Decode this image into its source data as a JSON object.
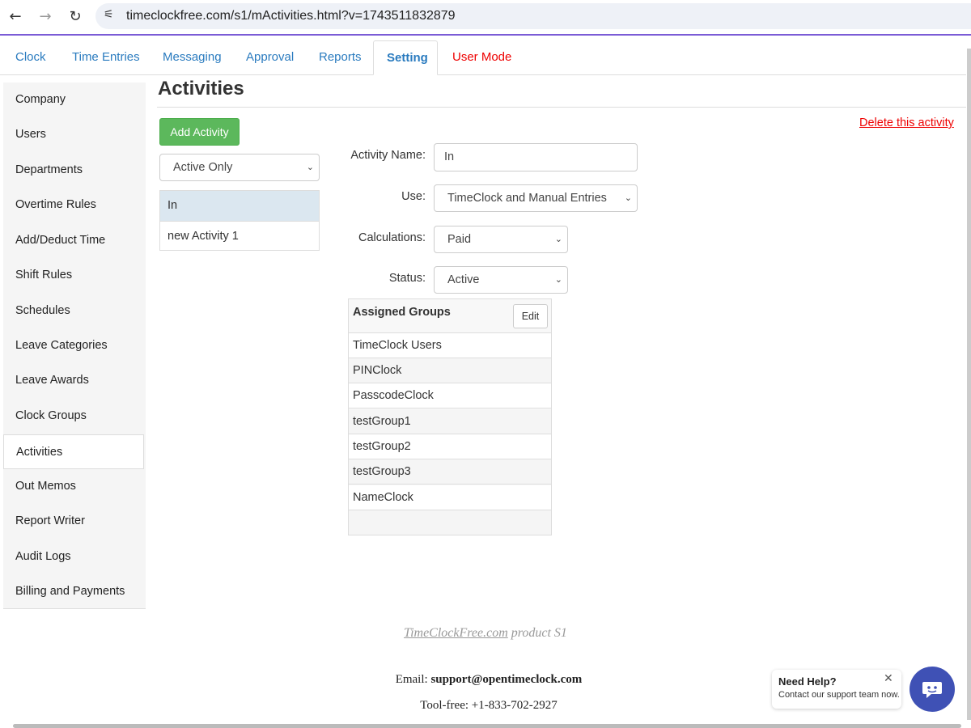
{
  "browser": {
    "back_icon": "←",
    "forward_icon": "→",
    "reload_icon": "↻",
    "site_icon": "⚟",
    "url": "timeclockfree.com/s1/mActivities.html?v=1743511832879"
  },
  "tabs": [
    {
      "label": "Clock"
    },
    {
      "label": "Time Entries"
    },
    {
      "label": "Messaging"
    },
    {
      "label": "Approval"
    },
    {
      "label": "Reports"
    },
    {
      "label": "Setting"
    },
    {
      "label": "User Mode"
    }
  ],
  "sidebar": {
    "items": [
      {
        "label": "Company"
      },
      {
        "label": "Users"
      },
      {
        "label": "Departments"
      },
      {
        "label": "Overtime Rules"
      },
      {
        "label": "Add/Deduct Time"
      },
      {
        "label": "Shift Rules"
      },
      {
        "label": "Schedules"
      },
      {
        "label": "Leave Categories"
      },
      {
        "label": "Leave Awards"
      },
      {
        "label": "Clock Groups"
      },
      {
        "label": "Activities"
      },
      {
        "label": "Out Memos"
      },
      {
        "label": "Report Writer"
      },
      {
        "label": "Audit Logs"
      },
      {
        "label": "Billing and Payments"
      }
    ]
  },
  "main": {
    "title": "Activities",
    "delete_link": "Delete this activity",
    "add_button": "Add Activity",
    "filter_select": "Active Only",
    "activities": [
      {
        "label": "In"
      },
      {
        "label": "new Activity 1"
      }
    ],
    "form": {
      "name_label": "Activity Name:",
      "name_value": "In",
      "use_label": "Use:",
      "use_value": "TimeClock and Manual Entries",
      "calc_label": "Calculations:",
      "calc_value": "Paid",
      "status_label": "Status:",
      "status_value": "Active"
    },
    "groups": {
      "title": "Assigned Groups",
      "edit_label": "Edit",
      "rows": [
        "TimeClock Users",
        "PINClock",
        "PasscodeClock",
        "testGroup1",
        "testGroup2",
        "testGroup3",
        "NameClock",
        ""
      ]
    }
  },
  "footer": {
    "product_link": "TimeClockFree.com",
    "product_suffix": " product S1",
    "email_label": "Email: ",
    "email_value": "support@opentimeclock.com",
    "phone": "Tool-free: +1-833-702-2927"
  },
  "help": {
    "title": "Need Help?",
    "subtitle": "Contact our support team now.",
    "close_icon": "✕"
  },
  "chevron": "⌄",
  "colors": {
    "accent": "#2a7bbf",
    "danger": "#e00000",
    "add_button": "#5cb85c",
    "help_button": "#3f51b5"
  }
}
